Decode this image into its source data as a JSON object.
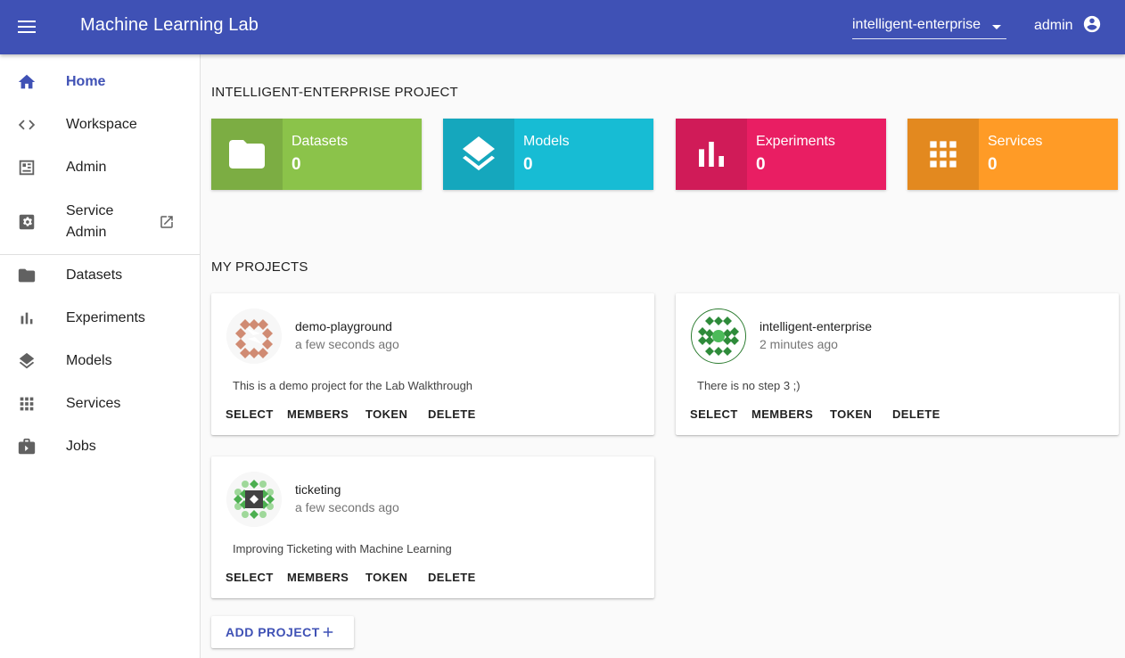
{
  "appbar": {
    "title": "Machine Learning Lab",
    "project_selector_value": "intelligent-enterprise",
    "user_name": "admin"
  },
  "sidebar": {
    "items": [
      {
        "label": "Home",
        "icon": "home-icon",
        "active": true
      },
      {
        "label": "Workspace",
        "icon": "code-icon"
      },
      {
        "label": "Admin",
        "icon": "admin-panel-icon"
      },
      {
        "label": "Service Admin",
        "icon": "settings-box-icon",
        "external": true
      },
      {
        "label": "Datasets",
        "icon": "folder-icon"
      },
      {
        "label": "Experiments",
        "icon": "bar-chart-icon"
      },
      {
        "label": "Models",
        "icon": "layers-icon"
      },
      {
        "label": "Services",
        "icon": "apps-grid-icon"
      },
      {
        "label": "Jobs",
        "icon": "briefcase-icon"
      }
    ]
  },
  "main": {
    "project_heading": "INTELLIGENT-ENTERPRISE PROJECT",
    "stats": [
      {
        "label": "Datasets",
        "value": "0",
        "color": "#8bc34a",
        "icon_bg": "#7cad43",
        "icon": "folder-icon"
      },
      {
        "label": "Models",
        "value": "0",
        "color": "#17bcd4",
        "icon_bg": "#15a7bd",
        "icon": "layers-icon"
      },
      {
        "label": "Experiments",
        "value": "0",
        "color": "#e91e63",
        "icon_bg": "#d01b58",
        "icon": "bar-chart-icon"
      },
      {
        "label": "Services",
        "value": "0",
        "color": "#ff9b26",
        "icon_bg": "#e3891f",
        "icon": "apps-grid-icon"
      }
    ],
    "projects_heading": "MY PROJECTS",
    "projects": [
      {
        "name": "demo-playground",
        "time": "a few seconds ago",
        "description": "This is a demo project for the Lab Walkthrough"
      },
      {
        "name": "intelligent-enterprise",
        "time": "2 minutes ago",
        "description": "There is no step 3 ;)"
      },
      {
        "name": "ticketing",
        "time": "a few seconds ago",
        "description": "Improving Ticketing with Machine Learning"
      }
    ],
    "project_actions": {
      "select": "SELECT",
      "members": "MEMBERS",
      "token": "TOKEN",
      "delete": "DELETE"
    },
    "add_project_label": "ADD PROJECT"
  },
  "colors": {
    "primary": "#3f51b5"
  }
}
